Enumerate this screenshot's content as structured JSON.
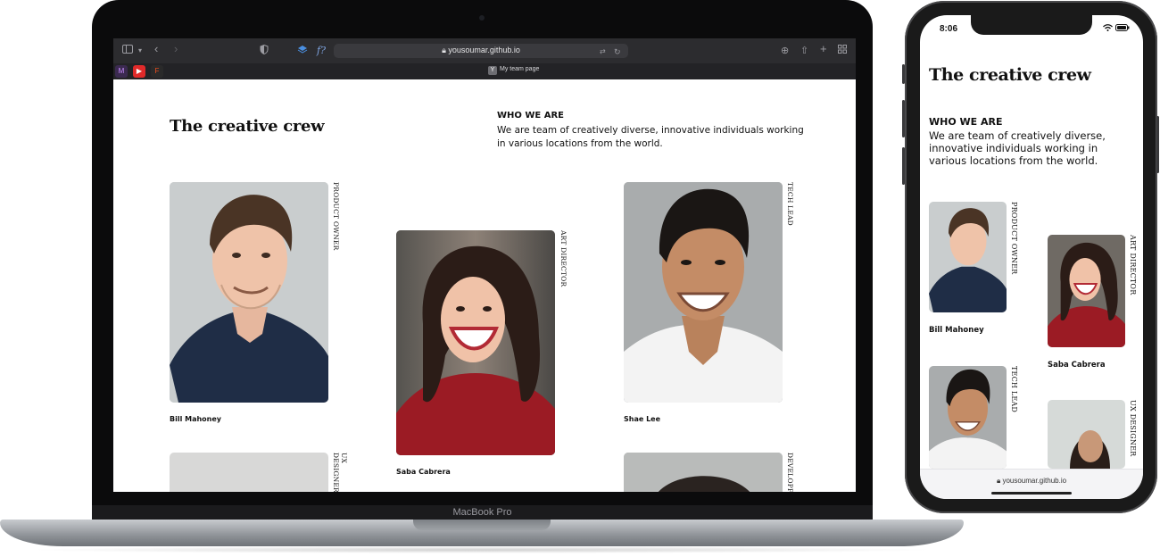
{
  "browser": {
    "url": "yousoumar.github.io",
    "tab_title": "My team page",
    "tab_favicon": "Y",
    "pinned_tabs": [
      "M",
      "▶",
      "F"
    ]
  },
  "laptop": {
    "model_label": "MacBook Pro"
  },
  "page": {
    "title": "The creative crew",
    "who_heading": "WHO WE ARE",
    "who_text": "We are team of creatively diverse, innovative individuals working in various locations from the world.",
    "members": [
      {
        "name": "Bill Mahoney",
        "role": "PRODUCT OWNER"
      },
      {
        "name": "Saba Cabrera",
        "role": "ART DIRECTOR"
      },
      {
        "name": "Shae Lee",
        "role": "TECH LEAD"
      },
      {
        "name": "",
        "role": "UX DESIGNER"
      },
      {
        "name": "",
        "role": "DEVELOPPER"
      }
    ]
  },
  "phone": {
    "time": "8:06",
    "url": "yousoumar.github.io"
  },
  "colors": {
    "accent_red": "#9b1b24",
    "navy_shirt": "#1d2c44",
    "page_bg": "#ffffff"
  }
}
